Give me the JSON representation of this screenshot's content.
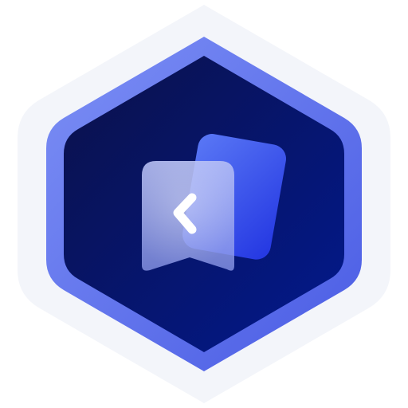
{
  "app_icon": {
    "name": "bookmark-back-badge",
    "colors": {
      "outer_halo": "#F3F5FA",
      "ring_light": "#7B8EF4",
      "ring_dark": "#4C5FE6",
      "core_top": "#0A1250",
      "core_bottom": "#031688",
      "rear_card_light": "#5B78F4",
      "rear_card_dark": "#2B3CE6",
      "front_card": "#A7B1F2",
      "chevron": "#FFFFFF"
    },
    "icons": [
      "hexagon-badge",
      "rear-card-icon",
      "bookmark-icon",
      "chevron-left-icon"
    ]
  }
}
